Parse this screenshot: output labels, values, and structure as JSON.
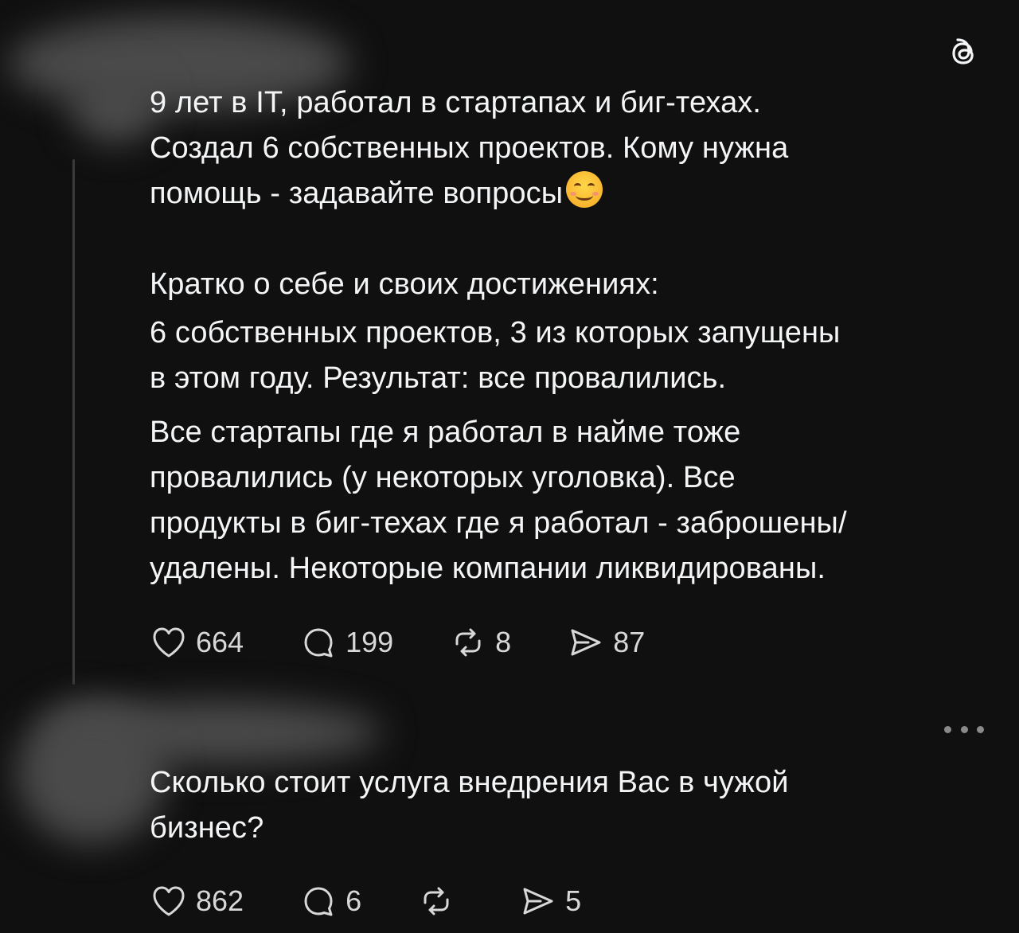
{
  "post": {
    "lines_para1": [
      "9 лет в IT, работал в стартапах и биг-техах.",
      "Создал 6 собственных проектов. Кому нужна",
      "помощь - задавайте вопросы"
    ],
    "lines_para2": [
      "Кратко о себе и своих достижениях:",
      "6 собственных проектов, 3 из которых запущены",
      "в этом году. Результат: все провалились.",
      "Все стартапы где я работал в найме тоже",
      "провалились (у некоторых уголовка). Все",
      "продукты в биг-техах где я работал - заброшены/",
      "удалены. Некоторые компании ликвидированы."
    ],
    "emoji": "smiling-face-emoji",
    "likes": "664",
    "replies": "199",
    "reposts": "8",
    "shares": "87"
  },
  "reply": {
    "lines": [
      "Сколько стоит услуга внедрения Вас в чужой",
      "бизнес?"
    ],
    "likes": "862",
    "replies": "6",
    "reposts": "",
    "shares": "5"
  },
  "icons": {
    "app_logo": "threads-logo-icon",
    "like": "heart-icon",
    "reply": "comment-icon",
    "repost": "repost-icon",
    "share": "share-icon",
    "more": "more-options-icon"
  },
  "colors": {
    "background": "#101010",
    "text": "#f3f5f7",
    "muted": "#8a8a8a"
  }
}
